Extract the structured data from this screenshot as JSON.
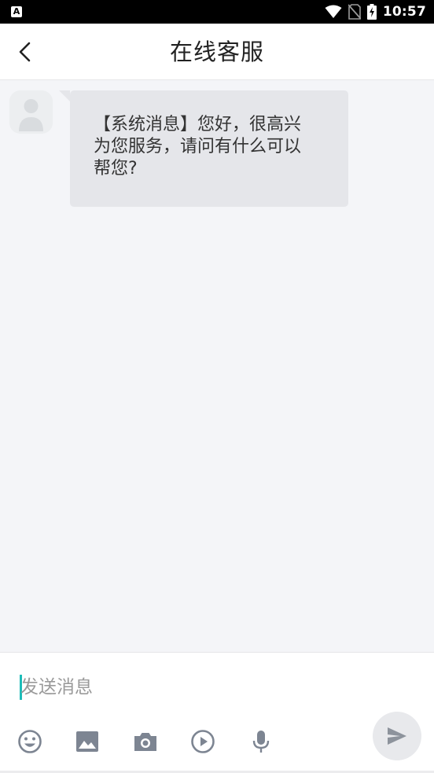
{
  "status_bar": {
    "notification_icon": "A",
    "time": "10:57",
    "icons": [
      "wifi-icon",
      "no-sim-icon",
      "battery-charging-icon"
    ]
  },
  "header": {
    "title": "在线客服",
    "back_icon": "chevron-left-icon"
  },
  "chat": {
    "messages": [
      {
        "sender": "system",
        "avatar_icon": "default-avatar-icon",
        "text": "【系统消息】您好，很高兴为您服务，请问有什么可以帮您?"
      }
    ]
  },
  "input_bar": {
    "placeholder": "发送消息",
    "value": "",
    "toolbar": [
      "emoji-icon",
      "image-icon",
      "camera-icon",
      "video-icon",
      "microphone-icon"
    ],
    "send_icon": "send-icon"
  },
  "colors": {
    "accent": "#1dbcb8",
    "icon": "#7d8592",
    "bubble": "#e5e6ea",
    "background": "#f4f5f8"
  }
}
